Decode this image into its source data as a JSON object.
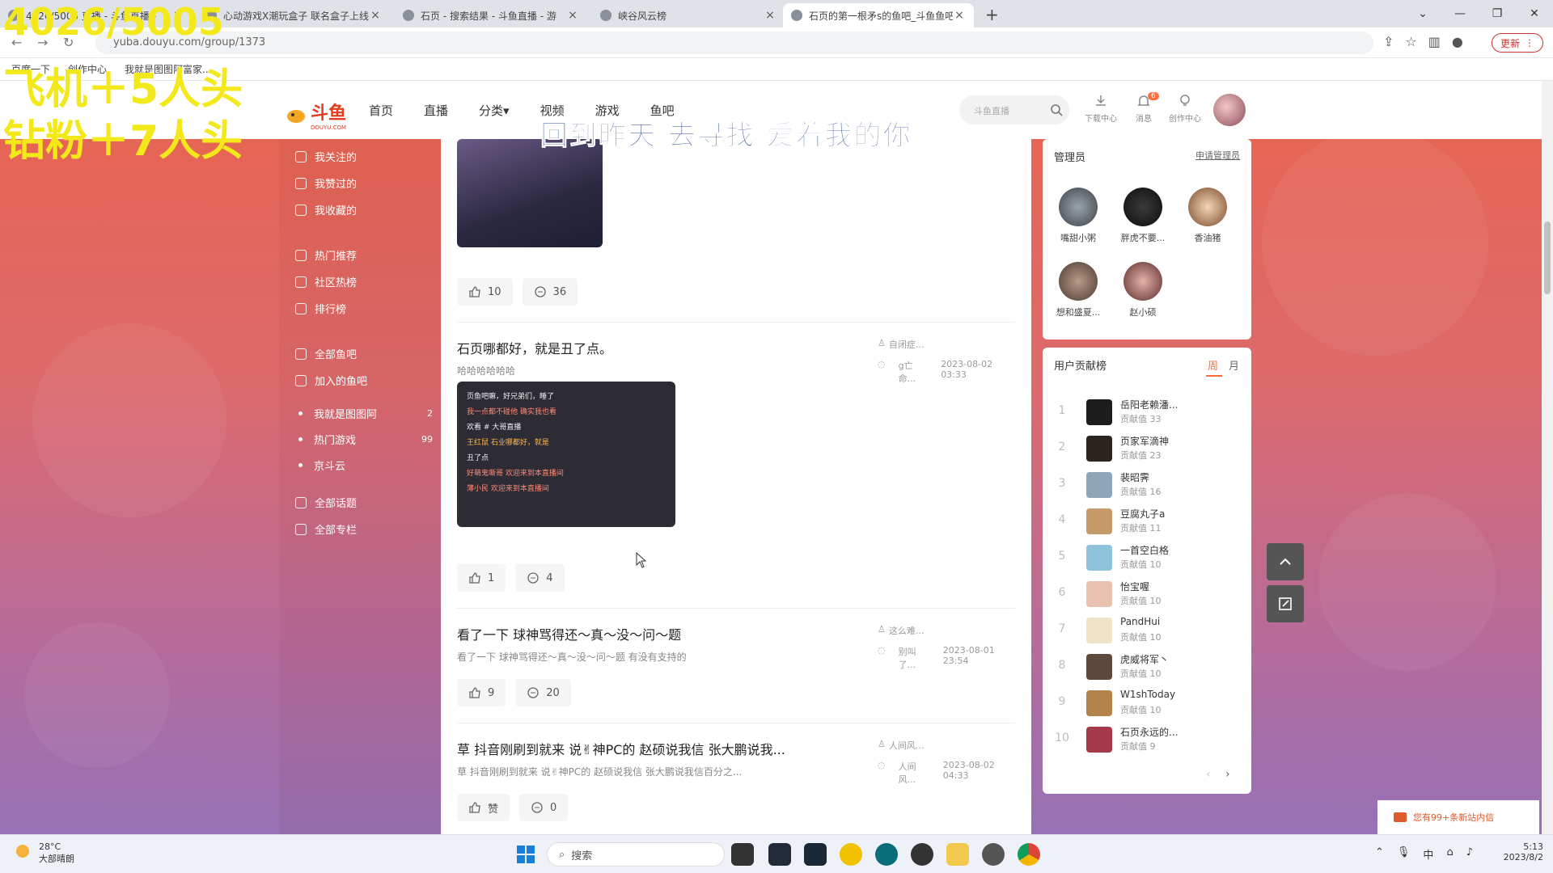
{
  "browser": {
    "tabs": [
      {
        "title": "4026/5005 直播 - 斗鱼直播 -"
      },
      {
        "title": "心动游戏X潮玩盒子 联名盒子上线"
      },
      {
        "title": "石页 - 搜索结果 - 斗鱼直播 - 游"
      },
      {
        "title": "峡谷风云榜"
      },
      {
        "title": "石页的第一根矛s的鱼吧_斗鱼鱼吧"
      }
    ],
    "url": "yuba.douyu.com/group/1373",
    "update_label": "更新",
    "bookmarks": [
      "百度一下",
      "创作中心",
      "我就是图图阿富家..."
    ]
  },
  "overlay": {
    "line1": "4026/5005",
    "line2": "飞机＋5人头",
    "line3": "钻粉＋7人头",
    "lyric": "回到昨天 去寻找 爱着我的你"
  },
  "site": {
    "logo": "斗鱼",
    "logo_sub": "DOUYU.COM",
    "nav": [
      "首页",
      "直播",
      "分类▾",
      "视频",
      "游戏",
      "鱼吧"
    ],
    "search_placeholder": "斗鱼直播",
    "header_icons": [
      {
        "label": "下载中心",
        "icon": "download-icon"
      },
      {
        "label": "消息",
        "icon": "bell-icon",
        "badge": "6"
      },
      {
        "label": "创作中心",
        "icon": "bulb-icon"
      }
    ]
  },
  "sidebar": {
    "items": [
      {
        "label": "我关注的"
      },
      {
        "label": "我赞过的"
      },
      {
        "label": "我收藏的"
      },
      {
        "label": "热门推荐"
      },
      {
        "label": "社区热榜"
      },
      {
        "label": "排行榜"
      },
      {
        "label": "全部鱼吧"
      },
      {
        "label": "加入的鱼吧"
      },
      {
        "label": "我就是图图阿",
        "count": "2"
      },
      {
        "label": "热门游戏",
        "count": "99"
      },
      {
        "label": "京斗云"
      },
      {
        "label": "全部话题"
      },
      {
        "label": "全部专栏"
      }
    ]
  },
  "posts": [
    {
      "likes": "10",
      "comments": "36"
    },
    {
      "title": "石页哪都好，就是丑了点。",
      "desc": "哈哈哈哈哈哈",
      "author": "自闭症...",
      "replier": "g亡命...",
      "time": "2023-08-02 03:33",
      "likes": "1",
      "comments": "4",
      "chat": [
        "页鱼吧嘛，好兄弟们，睡了",
        "我一点都不碰他 确实我也看",
        "欢看 # 大哥直播",
        "王红鼠 石业哪都好，就是",
        "丑了点",
        "好萌鬼嘶哥 欢迎来到本直播间",
        "薄小民 欢迎来到本直播间"
      ]
    },
    {
      "title": "看了一下 球神骂得还～真～没～问～题",
      "desc": "看了一下 球神骂得还～真～没～问～题 有没有支持的",
      "author": "这么难...",
      "replier": "别叫了...",
      "time": "2023-08-01 23:54",
      "likes": "9",
      "comments": "20"
    },
    {
      "title": "草 抖音刚刷到就来 说✌神PC的 赵硕说我信 张大鹏说我...",
      "desc": "草 抖音刚刷到就来 说✌神PC的 赵硕说我信 张大鹏说我信百分之...",
      "author": "人间风...",
      "replier": "人间风...",
      "time": "2023-08-02 04:33",
      "likes": "赞",
      "comments": "0"
    }
  ],
  "admins": {
    "title": "管理员",
    "apply": "申请管理员",
    "list": [
      {
        "name": "嘴甜小粥"
      },
      {
        "name": "胖虎不要..."
      },
      {
        "name": "香油猪"
      },
      {
        "name": "想和盛夏..."
      },
      {
        "name": "赵小硕"
      }
    ]
  },
  "ranking": {
    "title": "用户贡献榜",
    "tab_week": "周",
    "tab_month": "月",
    "prefix": "贡献值",
    "list": [
      {
        "rank": "1",
        "name": "岳阳老赖潘...",
        "value": "33"
      },
      {
        "rank": "2",
        "name": "页家军滴神",
        "value": "23"
      },
      {
        "rank": "3",
        "name": "裴昭霁",
        "value": "16"
      },
      {
        "rank": "4",
        "name": "豆腐丸子a",
        "value": "11"
      },
      {
        "rank": "5",
        "name": "一首空白格",
        "value": "10"
      },
      {
        "rank": "6",
        "name": "怡宝喔",
        "value": "10"
      },
      {
        "rank": "7",
        "name": "PandHui",
        "value": "10"
      },
      {
        "rank": "8",
        "name": "虎威将军丶",
        "value": "10"
      },
      {
        "rank": "9",
        "name": "W1shToday",
        "value": "10"
      },
      {
        "rank": "10",
        "name": "石页永远的...",
        "value": "9"
      }
    ]
  },
  "notice": "您有99+条新站内信",
  "taskbar": {
    "temp": "28°C",
    "weather": "大部晴朗",
    "search": "搜索",
    "ime": "中",
    "time": "5:13",
    "date": "2023/8/2"
  }
}
